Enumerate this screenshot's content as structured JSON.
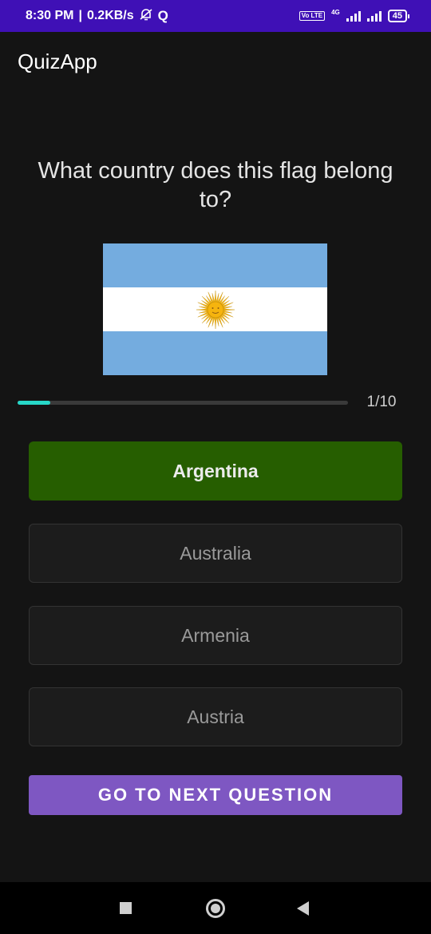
{
  "status_bar": {
    "time": "8:30 PM",
    "net_speed": "0.2KB/s",
    "volte": "Vo LTE",
    "network": "4G",
    "battery": "45",
    "icons": [
      "mute-bell-icon",
      "q-app-icon",
      "signal-icon",
      "battery-icon"
    ]
  },
  "app": {
    "title": "QuizApp"
  },
  "quiz": {
    "question": "What country does this flag belong to?",
    "flag_icon": "argentina-flag",
    "progress": {
      "current": 1,
      "total": 10,
      "label": "1/10"
    },
    "options": [
      {
        "label": "Argentina",
        "state": "correct"
      },
      {
        "label": "Australia",
        "state": "default"
      },
      {
        "label": "Armenia",
        "state": "default"
      },
      {
        "label": "Austria",
        "state": "default"
      }
    ],
    "next_button_label": "GO TO NEXT QUESTION"
  },
  "colors": {
    "status_bar": "#3f10b6",
    "background": "#141414",
    "correct": "#265e00",
    "accent": "#7e57c2",
    "progress": "#27d7c8",
    "flag_blue": "#74acdf",
    "sun": "#f6b40e"
  },
  "nav_bar": {
    "icons": [
      "recents-icon",
      "home-icon",
      "back-icon"
    ]
  }
}
